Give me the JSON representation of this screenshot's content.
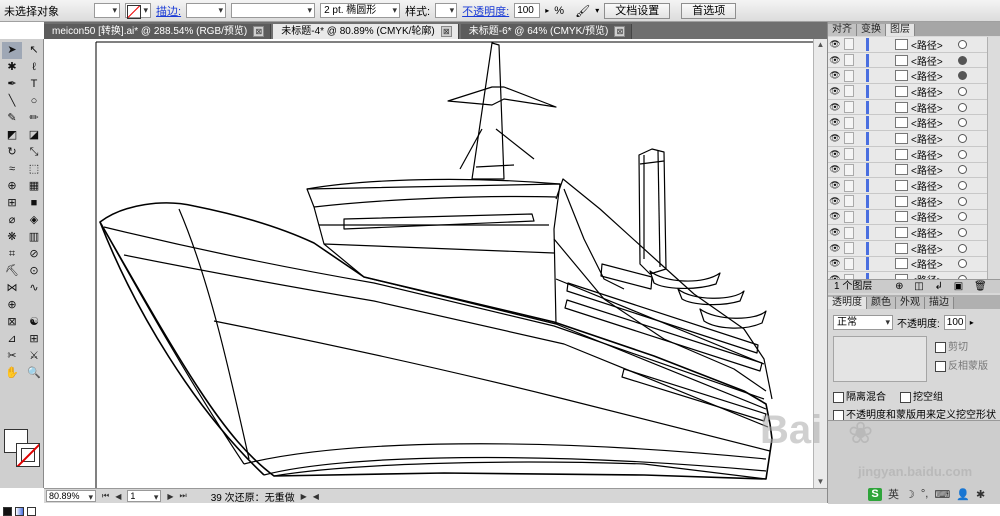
{
  "control_bar": {
    "selection_status": "未选择对象",
    "stroke_label": "描边:",
    "brush_value": "2 pt. 椭圆形",
    "style_label": "样式:",
    "opacity_label": "不透明度:",
    "opacity_value": "100",
    "percent": "%",
    "doc_setup_button": "文档设置",
    "prefs_button": "首选项"
  },
  "doc_tabs": [
    {
      "label": "meicon50 [转换].ai* @ 288.54% (RGB/预览)",
      "active": false
    },
    {
      "label": "未标题-4* @ 80.89% (CMYK/轮廓)",
      "active": true
    },
    {
      "label": "未标题-6* @ 64% (CMYK/预览)",
      "active": false
    }
  ],
  "tab_close": "⊠",
  "tools": [
    {
      "name": "selection-tool",
      "glyph": "➤"
    },
    {
      "name": "direct-selection-tool",
      "glyph": "↖"
    },
    {
      "name": "magic-wand-tool",
      "glyph": "✱"
    },
    {
      "name": "lasso-tool",
      "glyph": "ℓ"
    },
    {
      "name": "pen-tool",
      "glyph": "✒"
    },
    {
      "name": "type-tool",
      "glyph": "T"
    },
    {
      "name": "line-segment-tool",
      "glyph": "╲"
    },
    {
      "name": "ellipse-tool",
      "glyph": "○"
    },
    {
      "name": "paintbrush-tool",
      "glyph": "✎"
    },
    {
      "name": "pencil-tool",
      "glyph": "✏"
    },
    {
      "name": "blob-brush-tool",
      "glyph": "◩"
    },
    {
      "name": "eraser-tool",
      "glyph": "◪"
    },
    {
      "name": "rotate-tool",
      "glyph": "↻"
    },
    {
      "name": "scale-tool",
      "glyph": "⤡"
    },
    {
      "name": "warp-tool",
      "glyph": "≈"
    },
    {
      "name": "free-transform-tool",
      "glyph": "⬚"
    },
    {
      "name": "shape-builder-tool",
      "glyph": "⊕"
    },
    {
      "name": "perspective-grid-tool",
      "glyph": "▦"
    },
    {
      "name": "mesh-tool",
      "glyph": "⊞"
    },
    {
      "name": "gradient-tool",
      "glyph": "■"
    },
    {
      "name": "eyedropper-tool",
      "glyph": "⌀"
    },
    {
      "name": "blend-tool",
      "glyph": "◈"
    },
    {
      "name": "symbol-sprayer-tool",
      "glyph": "❋"
    },
    {
      "name": "column-graph-tool",
      "glyph": "▥"
    },
    {
      "name": "artboard-tool",
      "glyph": "⌗"
    },
    {
      "name": "slice-tool",
      "glyph": "⊘"
    },
    {
      "name": "live-paint-bucket-tool",
      "glyph": "⛏"
    },
    {
      "name": "live-paint-selection-tool",
      "glyph": "⊙"
    },
    {
      "name": "width-tool",
      "glyph": "⋈"
    },
    {
      "name": "warp-alt-tool",
      "glyph": "∿"
    },
    {
      "name": "crop-image-tool",
      "glyph": "⊕"
    },
    {
      "name": "puppet-tool",
      "glyph": " "
    },
    {
      "name": "rectangle-grid-tool",
      "glyph": "⊠"
    },
    {
      "name": "polar-grid-tool",
      "glyph": "☯"
    },
    {
      "name": "graph-alt-tool",
      "glyph": "⊿"
    },
    {
      "name": "flare-tool",
      "glyph": "⊞"
    },
    {
      "name": "scissors-tool",
      "glyph": "✂"
    },
    {
      "name": "knife-tool",
      "glyph": "⚔"
    },
    {
      "name": "hand-tool",
      "glyph": "✋"
    },
    {
      "name": "zoom-tool",
      "glyph": "🔍"
    }
  ],
  "status_bar": {
    "zoom": "80.89%",
    "page": "1",
    "history": "39 次还原：无重做"
  },
  "layers_panel": {
    "tabs": [
      "对齐",
      "变换",
      "图层"
    ],
    "active_tab": "图层",
    "rows": [
      {
        "name": "<路径>",
        "target_filled": false
      },
      {
        "name": "<路径>",
        "target_filled": true
      },
      {
        "name": "<路径>",
        "target_filled": true
      },
      {
        "name": "<路径>",
        "target_filled": false
      },
      {
        "name": "<路径>",
        "target_filled": false
      },
      {
        "name": "<路径>",
        "target_filled": false
      },
      {
        "name": "<路径>",
        "target_filled": false
      },
      {
        "name": "<路径>",
        "target_filled": false
      },
      {
        "name": "<路径>",
        "target_filled": false
      },
      {
        "name": "<路径>",
        "target_filled": false
      },
      {
        "name": "<路径>",
        "target_filled": false
      },
      {
        "name": "<路径>",
        "target_filled": false
      },
      {
        "name": "<路径>",
        "target_filled": false
      },
      {
        "name": "<路径>",
        "target_filled": false
      },
      {
        "name": "<路径>",
        "target_filled": false
      },
      {
        "name": "<路径>",
        "target_filled": false
      }
    ],
    "footer": "1 个图层"
  },
  "transparency_panel": {
    "tabs": [
      "透明度",
      "颜色",
      "外观",
      "描边"
    ],
    "active_tab": "透明度",
    "blend_mode": "正常",
    "opacity_label": "不透明度:",
    "opacity_value": "100",
    "clip_label": "剪切",
    "invert_mask_label": "反相蒙版",
    "isolate_blend_label": "隔离混合",
    "knockout_label": "挖空组",
    "opacity_mask_label": "不透明度和蒙版用来定义挖空形状"
  },
  "watermark": {
    "brand": "Bai",
    "sub": "jingyan.baidu.com"
  },
  "taskbar": {
    "ime": "英"
  }
}
